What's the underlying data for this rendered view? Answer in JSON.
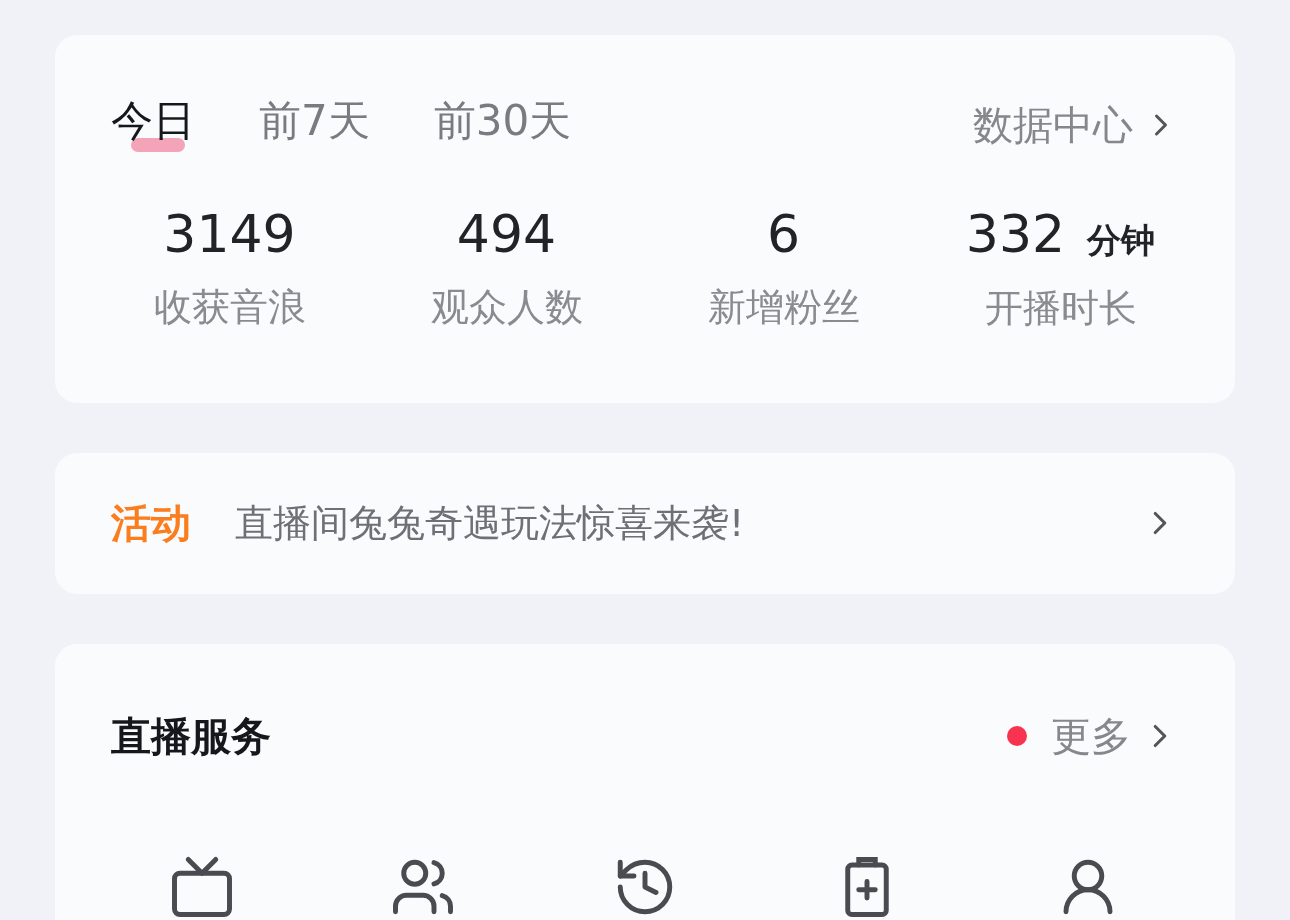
{
  "range_tabs": [
    {
      "label": "今日",
      "selected": true
    },
    {
      "label": "前7天",
      "selected": false
    },
    {
      "label": "前30天",
      "selected": false
    }
  ],
  "data_center_link": "数据中心",
  "stats": [
    {
      "value": "3149",
      "label": "收获音浪"
    },
    {
      "value": "494",
      "label": "观众人数"
    },
    {
      "value": "6",
      "label": "新增粉丝"
    },
    {
      "value": "332",
      "unit": "分钟",
      "label": "开播时长"
    }
  ],
  "activity": {
    "tag": "活动",
    "text": "直播间兔兔奇遇玩法惊喜来袭!"
  },
  "services": {
    "title": "直播服务",
    "more": "更多",
    "has_new": true
  }
}
